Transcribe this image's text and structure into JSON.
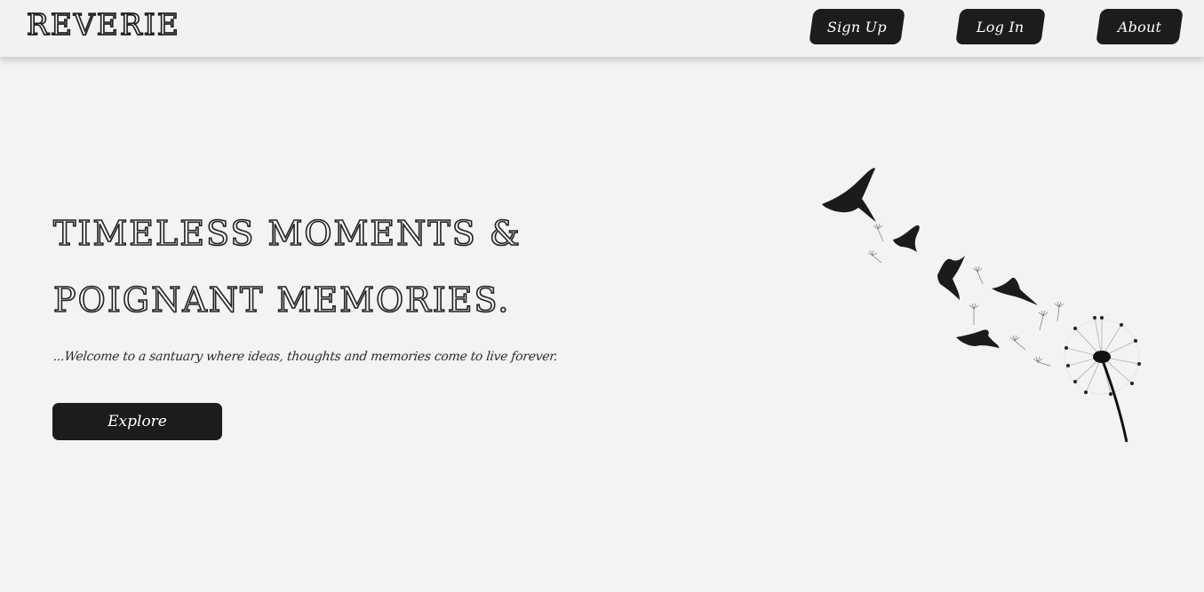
{
  "header": {
    "logo": "REVERIE",
    "nav": {
      "signup": "Sign Up",
      "login": "Log In",
      "about": "About"
    }
  },
  "hero": {
    "title_line1": "Timeless Moments &",
    "title_line2": "Poignant Memories.",
    "subtitle": "...Welcome to a santuary where ideas, thoughts and memories come to live forever.",
    "cta": "Explore"
  },
  "colors": {
    "background": "#f3f3f3",
    "button": "#1c1c1c",
    "button_text": "#ffffff"
  },
  "illustration": {
    "description_icon": "birds-and-dandelion-illustration"
  }
}
